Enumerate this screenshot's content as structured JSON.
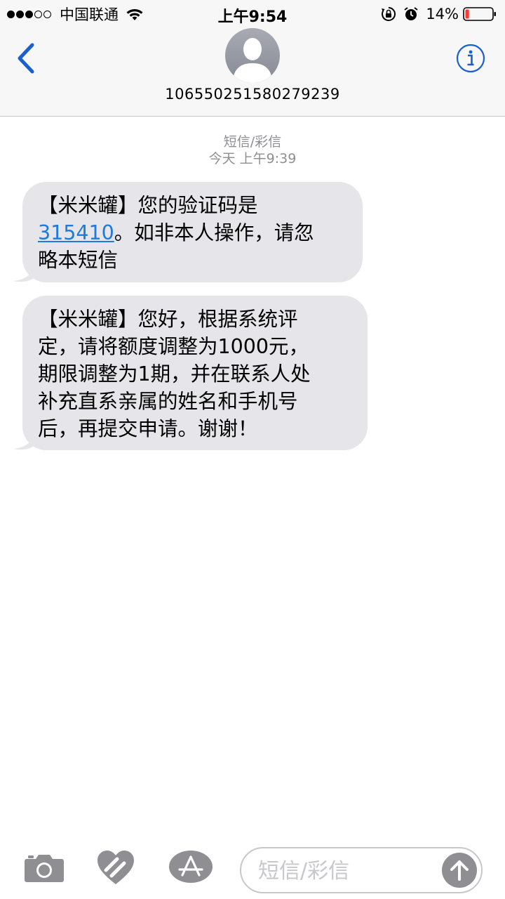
{
  "status_bar": {
    "carrier": "中国联通",
    "time": "上午9:54",
    "battery": "14%",
    "signal_bars_filled": 3,
    "signal_bars_total": 5,
    "battery_level": 0.14,
    "battery_color": "#ff3b30"
  },
  "header": {
    "contact_number": "106550251580279239",
    "back_icon": "chevron-left-icon",
    "info_icon": "info-icon",
    "avatar_icon": "person-silhouette-icon",
    "accent_color": "#1a5fd0"
  },
  "thread": {
    "service_label": "短信/彩信",
    "timestamp": "今天 上午9:39"
  },
  "messages": [
    {
      "lines": [
        [
          {
            "text": "【米米罐】您的验证码是",
            "link": false
          }
        ],
        [
          {
            "text": "315410",
            "link": true
          },
          {
            "text": "。如非本人操作，请忽",
            "link": false
          }
        ],
        [
          {
            "text": "略本短信",
            "link": false
          }
        ]
      ]
    },
    {
      "lines": [
        [
          {
            "text": "【米米罐】您好，根据系统评",
            "link": false
          }
        ],
        [
          {
            "text": "定，请将额度调整为1000元，",
            "link": false
          }
        ],
        [
          {
            "text": "期限调整为1期，并在联系人处",
            "link": false
          }
        ],
        [
          {
            "text": "补充直系亲属的姓名和手机号",
            "link": false
          }
        ],
        [
          {
            "text": "后，再提交申请。谢谢！",
            "link": false
          }
        ]
      ]
    }
  ],
  "input_bar": {
    "placeholder": "短信/彩信",
    "camera_icon": "camera-icon",
    "digital_touch_icon": "digital-touch-heart-icon",
    "appstore_icon": "app-store-icon",
    "send_icon": "arrow-up-icon"
  },
  "colors": {
    "bubble_bg": "#e5e5ea",
    "link": "#1f7ae0",
    "meta_text": "#8e8e93",
    "bar_bg": "#f7f7f7"
  }
}
